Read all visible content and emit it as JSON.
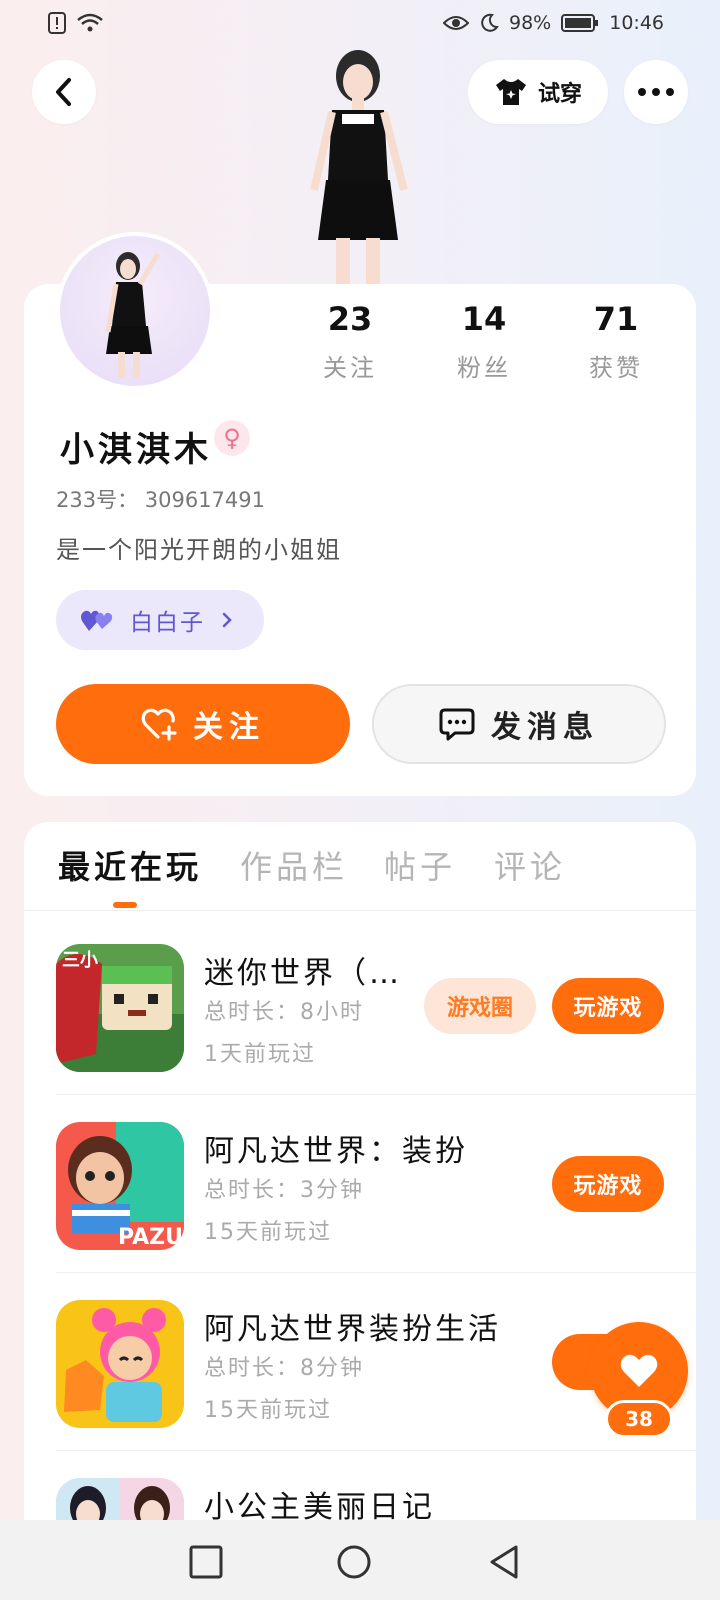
{
  "status_bar": {
    "battery": "98%",
    "time": "10:46"
  },
  "header": {
    "tryon_label": "试穿"
  },
  "profile": {
    "stats": [
      {
        "value": "23",
        "label": "关注"
      },
      {
        "value": "14",
        "label": "粉丝"
      },
      {
        "value": "71",
        "label": "获赞"
      }
    ],
    "username": "小淇淇木",
    "gender_symbol": "♀",
    "user_id": "233号： 309617491",
    "bio": "是一个阳光开朗的小姐姐",
    "guild_tag": "白白子",
    "follow_label": "关注",
    "message_label": "发消息"
  },
  "tabs": [
    {
      "label": "最近在玩",
      "active": true
    },
    {
      "label": "作品栏",
      "active": false
    },
    {
      "label": "帖子",
      "active": false
    },
    {
      "label": "评论",
      "active": false
    }
  ],
  "games": [
    {
      "title": "迷你世界（…",
      "duration": "总时长：8小时",
      "last_played": "1天前玩过",
      "circle_label": "游戏圈",
      "play_label": "玩游戏"
    },
    {
      "title": "阿凡达世界：装扮",
      "duration": "总时长：3分钟",
      "last_played": "15天前玩过",
      "play_label": "玩游戏"
    },
    {
      "title": "阿凡达世界装扮生活",
      "duration": "总时长：8分钟",
      "last_played": "15天前玩过",
      "play_label": "玩"
    },
    {
      "title": "小公主美丽日记"
    }
  ],
  "fab": {
    "like_count": "38"
  },
  "colors": {
    "accent": "#ff6d0c",
    "guild": "#6156d4"
  }
}
